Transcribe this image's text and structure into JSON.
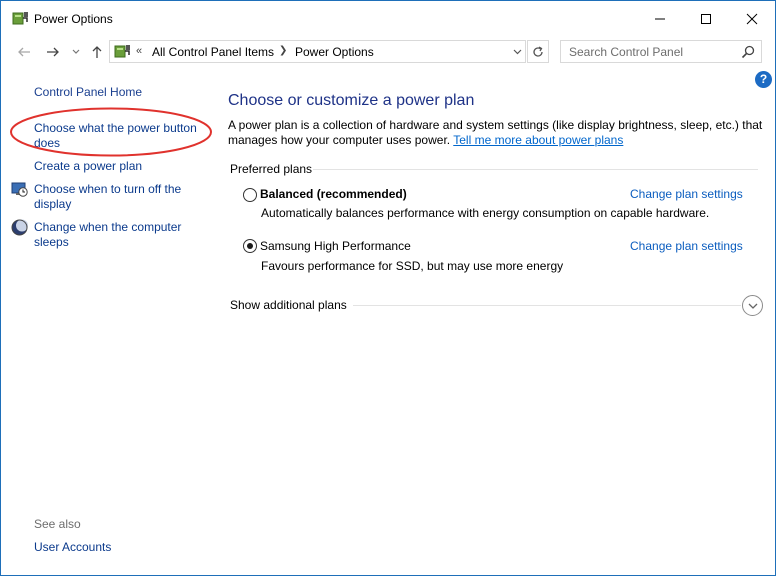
{
  "window": {
    "title": "Power Options",
    "icon": "power-options-icon"
  },
  "navigation": {
    "breadcrumb": [
      "All Control Panel Items",
      "Power Options"
    ],
    "breadcrumb_overflow": "«",
    "search_placeholder": "Search Control Panel"
  },
  "sidebar": {
    "home_label": "Control Panel Home",
    "links": [
      {
        "label": "Choose what the power button does"
      },
      {
        "label": "Create a power plan"
      },
      {
        "label": "Choose when to turn off the display",
        "icon": "display-timer-icon"
      },
      {
        "label": "Change when the computer sleeps",
        "icon": "sleep-moon-icon"
      }
    ],
    "see_also_label": "See also",
    "see_also_links": [
      {
        "label": "User Accounts"
      }
    ]
  },
  "main": {
    "heading": "Choose or customize a power plan",
    "description": "A power plan is a collection of hardware and system settings (like display brightness, sleep, etc.) that manages how your computer uses power.",
    "description_link": "Tell me more about power plans",
    "preferred_label": "Preferred plans",
    "plans": [
      {
        "name": "Balanced (recommended)",
        "description": "Automatically balances performance with energy consumption on capable hardware.",
        "selected": false,
        "settings_link": "Change plan settings"
      },
      {
        "name": "Samsung High Performance",
        "description": "Favours performance for SSD, but may use more energy",
        "selected": true,
        "settings_link": "Change plan settings"
      }
    ],
    "additional_label": "Show additional plans"
  },
  "colors": {
    "link": "#0b5dbf",
    "heading": "#1e3287",
    "annotation": "#e0322d",
    "window_border": "#1e6fb9"
  }
}
